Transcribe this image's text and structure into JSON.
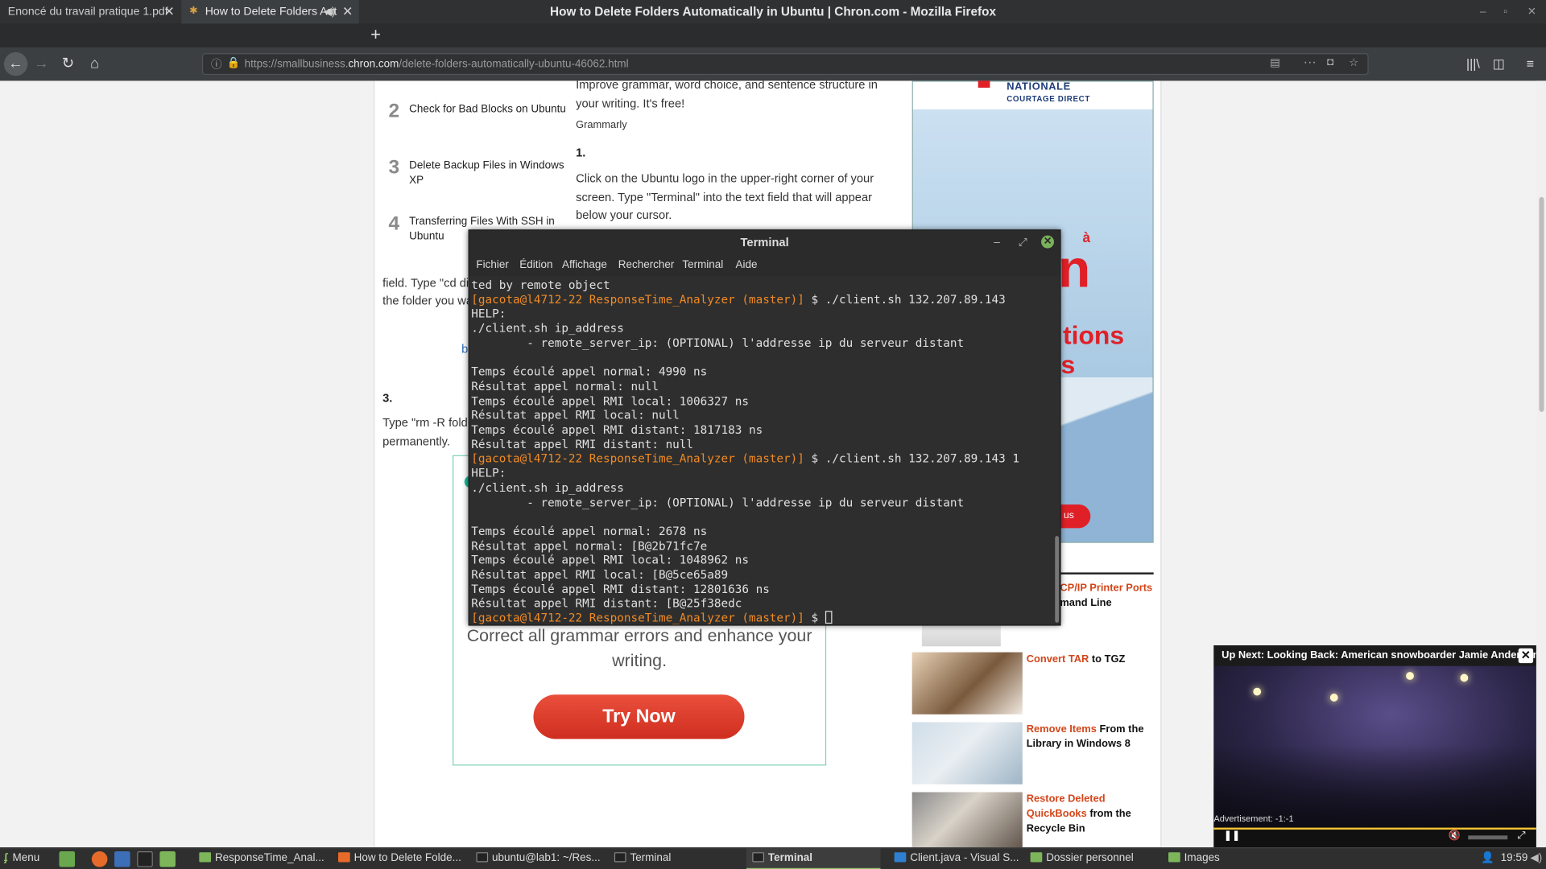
{
  "window": {
    "title": "How to Delete Folders Automatically in Ubuntu | Chron.com - Mozilla Firefox"
  },
  "tabs": [
    {
      "label": "Enoncé du travail pratique 1.pdf"
    },
    {
      "label": "How to Delete Folders Aut"
    }
  ],
  "browser": {
    "url_domain_pre": "https://smallbusiness.",
    "url_domain": "chron.com",
    "url_path": "/delete-folders-automatically-ubuntu-46062.html"
  },
  "article": {
    "related": [
      {
        "num": "2",
        "title": "Check for Bad Blocks on Ubuntu"
      },
      {
        "num": "3",
        "title": "Delete Backup Files in Windows XP"
      },
      {
        "num": "4",
        "title": "Transferring Files With SSH in Ubuntu"
      }
    ],
    "ad_text": "Improve grammar, word choice, and sentence structure in your writing. It's free!",
    "ad_brand": "Grammarly",
    "step1_num": "1.",
    "step1_text": "Click on the Ubuntu logo in the upper-right corner of your screen. Type \"Terminal\" into the text field that will appear below your cursor.",
    "partial1": "field. Type \"cd dir",
    "partial2": "the folder you wa",
    "partial_link": "b",
    "step3_num": "3.",
    "step3_a": "Type \"rm -R folde",
    "step3_b": "permanently.",
    "grammar_ad_text": "Correct all grammar errors and enhance your writing.",
    "grammar_ad_button": "Try Now"
  },
  "sidebar_ad": {
    "top1": "NATIONALE",
    "top2": "COURTAGE DIRECT",
    "big1": "à",
    "big2": "n",
    "big3": "tions",
    "big4": "s",
    "button": "us"
  },
  "sidebar_links": [
    {
      "orange": "CP/IP Printer Ports",
      "rest": "mand Line"
    },
    {
      "orange": "Convert TAR",
      "rest": " to TGZ"
    },
    {
      "orange": "Remove Items",
      "rest": " From the Library in Windows 8"
    },
    {
      "orange": "Restore Deleted QuickBooks",
      "rest": " from the Recycle Bin"
    }
  ],
  "terminal": {
    "title": "Terminal",
    "menu": [
      "Fichier",
      "Édition",
      "Affichage",
      "Rechercher",
      "Terminal",
      "Aide"
    ],
    "lines": [
      {
        "t": "ted by remote object",
        "prompt": false
      },
      {
        "t": "[gacota@l4712-22 ResponseTime_Analyzer (master)] $ ",
        "cmd": "./client.sh 132.207.89.143",
        "prompt": true
      },
      {
        "t": "HELP:",
        "prompt": false
      },
      {
        "t": "./client.sh ip_address",
        "prompt": false
      },
      {
        "t": "        - remote_server_ip: (OPTIONAL) l'addresse ip du serveur distant",
        "prompt": false
      },
      {
        "t": "",
        "prompt": false
      },
      {
        "t": "Temps écoulé appel normal: 4990 ns",
        "prompt": false
      },
      {
        "t": "Résultat appel normal: null",
        "prompt": false
      },
      {
        "t": "Temps écoulé appel RMI local: 1006327 ns",
        "prompt": false
      },
      {
        "t": "Résultat appel RMI local: null",
        "prompt": false
      },
      {
        "t": "Temps écoulé appel RMI distant: 1817183 ns",
        "prompt": false
      },
      {
        "t": "Résultat appel RMI distant: null",
        "prompt": false
      },
      {
        "t": "[gacota@l4712-22 ResponseTime_Analyzer (master)] $ ",
        "cmd": "./client.sh 132.207.89.143 1",
        "prompt": true
      },
      {
        "t": "HELP:",
        "prompt": false
      },
      {
        "t": "./client.sh ip_address",
        "prompt": false
      },
      {
        "t": "        - remote_server_ip: (OPTIONAL) l'addresse ip du serveur distant",
        "prompt": false
      },
      {
        "t": "",
        "prompt": false
      },
      {
        "t": "Temps écoulé appel normal: 2678 ns",
        "prompt": false
      },
      {
        "t": "Résultat appel normal: [B@2b71fc7e",
        "prompt": false
      },
      {
        "t": "Temps écoulé appel RMI local: 1048962 ns",
        "prompt": false
      },
      {
        "t": "Résultat appel RMI local: [B@5ce65a89",
        "prompt": false
      },
      {
        "t": "Temps écoulé appel RMI distant: 12801636 ns",
        "prompt": false
      },
      {
        "t": "Résultat appel RMI distant: [B@25f38edc",
        "prompt": false
      },
      {
        "t": "[gacota@l4712-22 ResponseTime_Analyzer (master)] $ ",
        "cmd": "",
        "prompt": true,
        "cursor": true
      }
    ]
  },
  "video": {
    "caption": "Up Next: Looking Back: American snowboarder Jamie Anderson w...",
    "ad_label": "Advertisement: -1:-1"
  },
  "taskbar": {
    "menu": "Menu",
    "items": [
      "ResponseTime_Anal...",
      "How to Delete Folde...",
      "ubuntu@lab1: ~/Res...",
      "Terminal",
      "Terminal",
      "Client.java - Visual S...",
      "Dossier personnel",
      "Images"
    ],
    "clock": "19:59"
  },
  "colors": {
    "accent": "#f08a24",
    "brand_red": "#e02027",
    "link_orange": "#d4461a"
  }
}
